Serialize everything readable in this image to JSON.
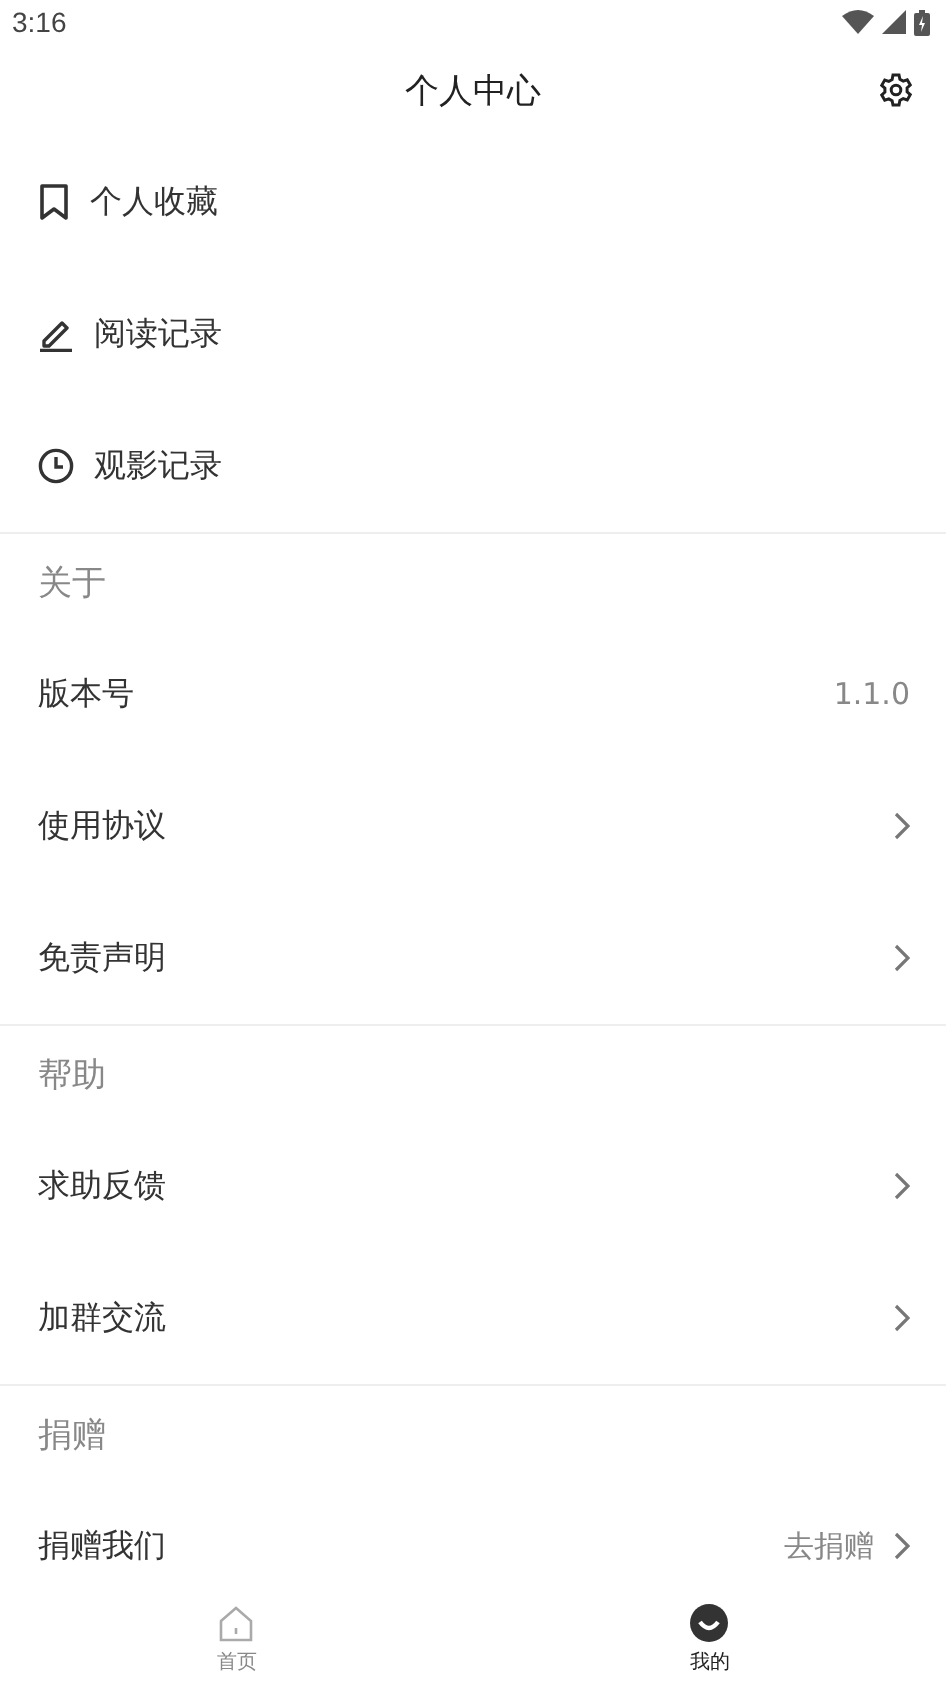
{
  "status_bar": {
    "time": "3:16"
  },
  "header": {
    "title": "个人中心"
  },
  "quick_links": [
    {
      "label": "个人收藏"
    },
    {
      "label": "阅读记录"
    },
    {
      "label": "观影记录"
    }
  ],
  "sections": [
    {
      "title": "关于",
      "items": [
        {
          "kind": "value",
          "label": "版本号",
          "value": "1.1.0"
        },
        {
          "kind": "link",
          "label": "使用协议"
        },
        {
          "kind": "link",
          "label": "免责声明"
        }
      ]
    },
    {
      "title": "帮助",
      "items": [
        {
          "kind": "link",
          "label": "求助反馈"
        },
        {
          "kind": "link",
          "label": "加群交流"
        }
      ]
    },
    {
      "title": "捐赠",
      "items": [
        {
          "kind": "action",
          "label": "捐赠我们",
          "value": "去捐赠"
        }
      ]
    }
  ],
  "tab_bar": [
    {
      "label": "首页",
      "selected": false
    },
    {
      "label": "我的",
      "selected": true
    }
  ]
}
